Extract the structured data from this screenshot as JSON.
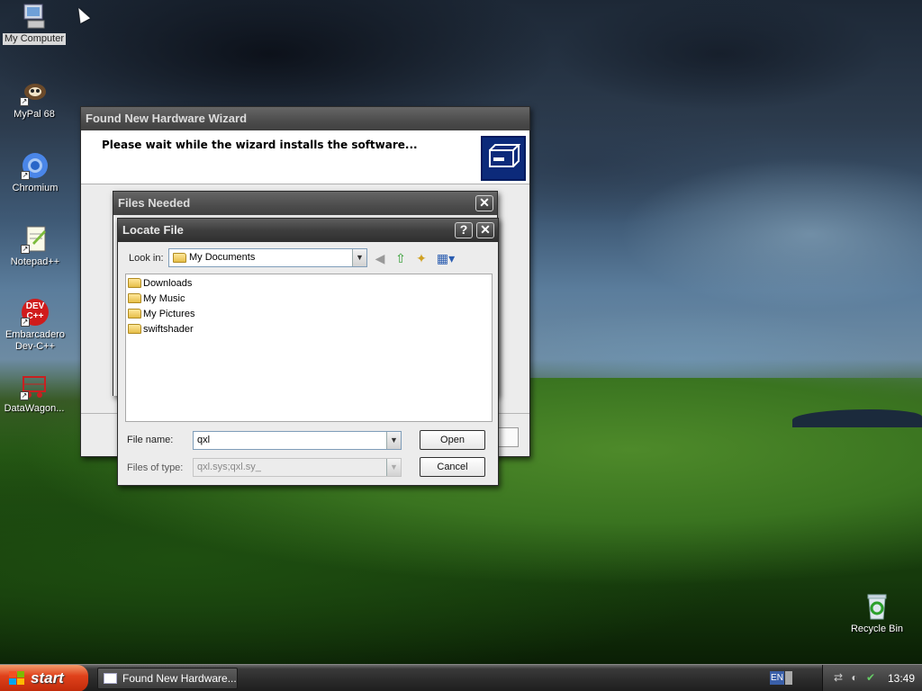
{
  "desktop": {
    "icons": [
      {
        "label": "My Computer",
        "icon": "computer-icon"
      },
      {
        "label": "MyPal 68",
        "icon": "mypal-icon"
      },
      {
        "label": "Chromium",
        "icon": "chromium-icon"
      },
      {
        "label": "Notepad++",
        "icon": "notepad-plus-plus-icon"
      },
      {
        "label": "Embarcadero Dev-C++",
        "line1": "Embarcadero",
        "line2": "Dev-C++",
        "icon": "devcpp-icon",
        "badge": "DEV C++"
      },
      {
        "label": "DataWagon...",
        "icon": "datawagon-icon"
      },
      {
        "label": "Recycle Bin",
        "icon": "recycle-bin-icon"
      }
    ]
  },
  "wizard": {
    "title": "Found New Hardware Wizard",
    "header_text": "Please wait while the wizard installs the software..."
  },
  "files_needed": {
    "title": "Files Needed",
    "close": "✕"
  },
  "locate_file": {
    "title": "Locate File",
    "help": "?",
    "close": "✕",
    "look_in_label": "Look in:",
    "look_in_value": "My Documents",
    "files": [
      "Downloads",
      "My Music",
      "My Pictures",
      "swiftshader"
    ],
    "file_name_label": "File name:",
    "file_name_value": "qxl",
    "files_of_type_label": "Files of type:",
    "files_of_type_value": "qxl.sys;qxl.sy_",
    "open_label": "Open",
    "cancel_label": "Cancel"
  },
  "taskbar": {
    "start_label": "start",
    "task_label": "Found New Hardware...",
    "lang": "EN",
    "clock": "13:49"
  },
  "colors": {
    "start_button": "#e0421c",
    "titlebar": "#3e3e3e",
    "wizard_header_icon": "#0c2a7a"
  }
}
